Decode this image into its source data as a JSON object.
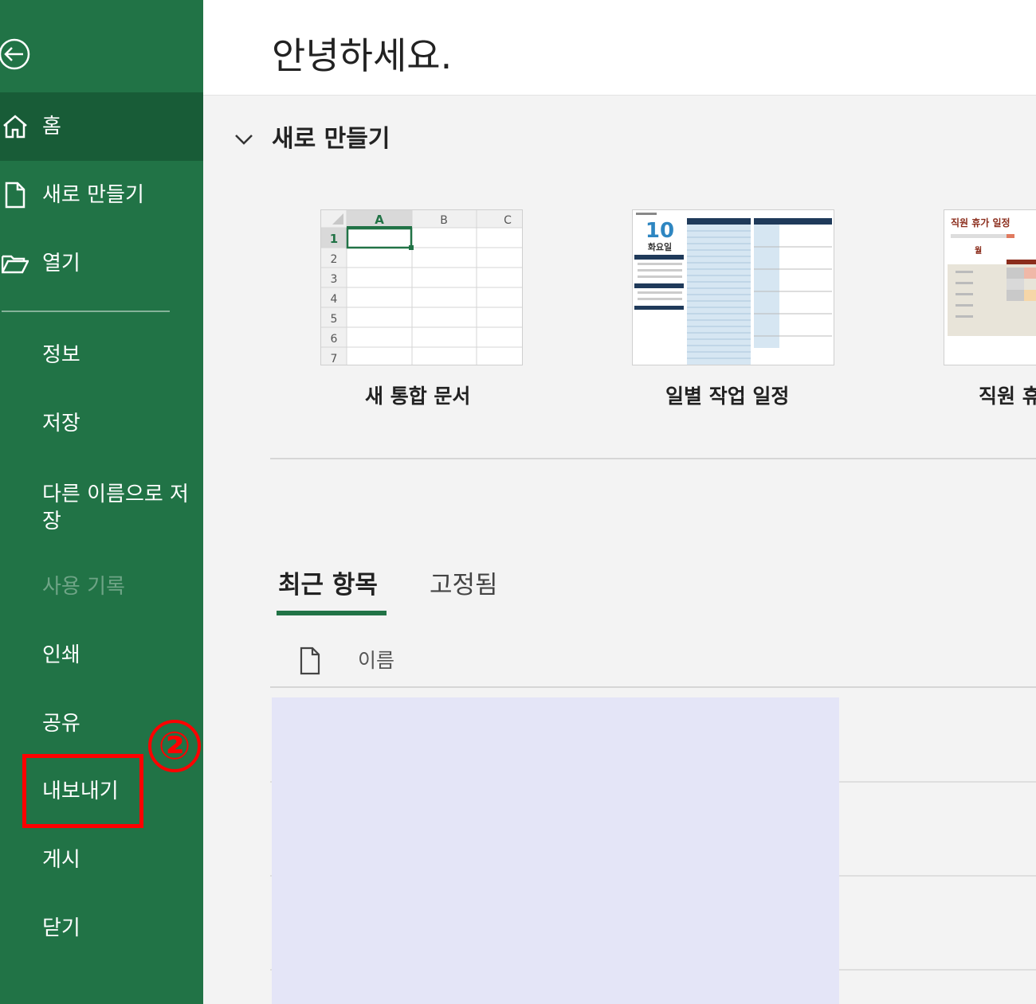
{
  "sidebar": {
    "back": {
      "icon": "back-arrow-icon"
    },
    "nav": [
      {
        "label": "홈",
        "icon": "home-icon"
      },
      {
        "label": "새로 만들기",
        "icon": "new-document-icon"
      },
      {
        "label": "열기",
        "icon": "open-folder-icon"
      }
    ],
    "menu": [
      {
        "label": "정보"
      },
      {
        "label": "저장"
      },
      {
        "label": "다른 이름으로 저장"
      },
      {
        "label": "사용 기록",
        "disabled": true
      },
      {
        "label": "인쇄"
      },
      {
        "label": "공유"
      },
      {
        "label": "내보내기"
      },
      {
        "label": "게시"
      },
      {
        "label": "닫기"
      }
    ],
    "annotation": {
      "step": "②",
      "color": "#ff0000"
    },
    "colors": {
      "background": "#217346",
      "selected": "#185c37"
    }
  },
  "main": {
    "greeting": "안녕하세요.",
    "new_section": {
      "title": "새로 만들기",
      "templates": [
        {
          "name": "새 통합 문서",
          "thumb": {
            "columns": [
              "A",
              "B",
              "C"
            ],
            "rows": [
              "1",
              "2",
              "3",
              "4",
              "5",
              "6",
              "7"
            ]
          }
        },
        {
          "name": "일별 작업 일정",
          "thumb": {
            "big_number": "10",
            "day": "화요일"
          }
        },
        {
          "name": "직원 휴",
          "thumb": {
            "title": "직원 휴가 일정",
            "month": "월"
          }
        }
      ]
    },
    "tabs": [
      {
        "label": "최근 항목",
        "active": true
      },
      {
        "label": "고정됨",
        "active": false
      }
    ],
    "list_header": {
      "name_label": "이름",
      "icon": "file-icon"
    }
  }
}
